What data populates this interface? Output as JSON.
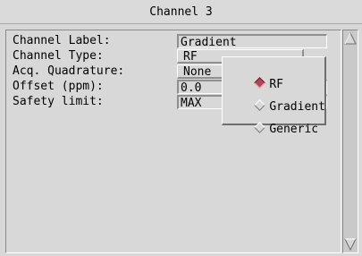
{
  "window": {
    "title": "Channel 3"
  },
  "form": {
    "channel_label": {
      "label": "Channel Label:",
      "value": "Gradient"
    },
    "channel_type": {
      "label": "Channel Type:",
      "value": "RF"
    },
    "acq_quadrature": {
      "label": "Acq. Quadrature:",
      "value": "None"
    },
    "offset": {
      "label": "Offset (ppm):",
      "value": "0.0"
    },
    "safety_limit": {
      "label": "Safety limit:",
      "value": "MAX"
    }
  },
  "channel_type_menu": {
    "options": [
      "RF",
      "Gradient",
      "Generic"
    ],
    "selected": "RF"
  },
  "colors": {
    "background": "#d8d8d8",
    "selected_radio": "#b0465a"
  },
  "icons": {
    "scroll_up": "triangle-up-icon",
    "scroll_down": "triangle-down-icon",
    "radio_on": "diamond-selected-icon",
    "radio_off": "diamond-unselected-icon"
  }
}
